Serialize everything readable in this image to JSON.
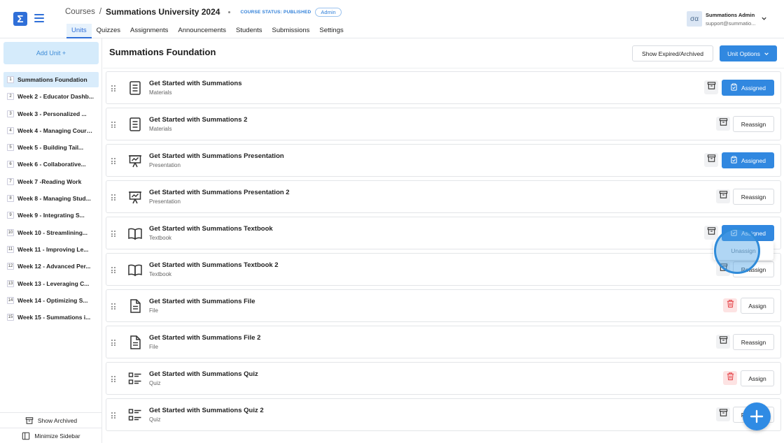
{
  "header": {
    "logo_glyph": "Σ",
    "breadcrumb": {
      "courses": "Courses",
      "separator": "/",
      "course": "Summations University 2024"
    },
    "course_status": "COURSE STATUS: PUBLISHED",
    "role_badge": "Admin",
    "tabs": [
      "Units",
      "Quizzes",
      "Assignments",
      "Announcements",
      "Students",
      "Submissions",
      "Settings"
    ],
    "active_tab": "Units",
    "user": {
      "avatar_text": "σα",
      "name": "Summations Admin",
      "email": "support@summatio..."
    }
  },
  "sidebar": {
    "add_unit_label": "Add Unit +",
    "units": [
      {
        "num": "1",
        "label": "Summations Foundation"
      },
      {
        "num": "2",
        "label": "Week 2 - Educator Dashb..."
      },
      {
        "num": "3",
        "label": "Week 3 - Personalized ..."
      },
      {
        "num": "4",
        "label": "Week 4 - Managing Cours..."
      },
      {
        "num": "5",
        "label": "Week 5 - Building Tail..."
      },
      {
        "num": "6",
        "label": "Week 6 - Collaborative..."
      },
      {
        "num": "7",
        "label": "Week 7 -Reading Work"
      },
      {
        "num": "8",
        "label": "Week 8 - Managing Stud..."
      },
      {
        "num": "9",
        "label": "Week 9 - Integrating S..."
      },
      {
        "num": "10",
        "label": "Week 10 - Streamlining..."
      },
      {
        "num": "11",
        "label": "Week 11 - Improving Le..."
      },
      {
        "num": "12",
        "label": "Week 12 - Advanced Per..."
      },
      {
        "num": "13",
        "label": "Week 13 - Leveraging C..."
      },
      {
        "num": "14",
        "label": "Week 14 - Optimizing S..."
      },
      {
        "num": "15",
        "label": "Week 15 - Summations i..."
      }
    ],
    "show_archived_label": "Show Archived",
    "minimize_label": "Minimize Sidebar"
  },
  "main": {
    "title": "Summations Foundation",
    "show_expired_label": "Show Expired/Archived",
    "unit_options_label": "Unit Options",
    "items": [
      {
        "title": "Get Started with Summations",
        "type": "Materials",
        "icon": "document-icon",
        "state": "Assigned",
        "archive_color": "grey"
      },
      {
        "title": "Get Started with Summations 2",
        "type": "Materials",
        "icon": "document-icon",
        "state": "Reassign",
        "archive_color": "grey"
      },
      {
        "title": "Get Started with Summations Presentation",
        "type": "Presentation",
        "icon": "presentation-icon",
        "state": "Assigned",
        "archive_color": "grey"
      },
      {
        "title": "Get Started with Summations Presentation 2",
        "type": "Presentation",
        "icon": "presentation-icon",
        "state": "Reassign",
        "archive_color": "grey"
      },
      {
        "title": "Get Started with Summations Textbook",
        "type": "Textbook",
        "icon": "book-icon",
        "state": "Assigned",
        "archive_color": "grey"
      },
      {
        "title": "Get Started with Summations Textbook 2",
        "type": "Textbook",
        "icon": "book-icon",
        "state": "Reassign",
        "archive_color": "grey"
      },
      {
        "title": "Get Started with Summations File",
        "type": "File",
        "icon": "file-icon",
        "state": "Assign",
        "archive_color": "red"
      },
      {
        "title": "Get Started with Summations File 2",
        "type": "File",
        "icon": "file-icon",
        "state": "Reassign",
        "archive_color": "grey"
      },
      {
        "title": "Get Started with Summations Quiz",
        "type": "Quiz",
        "icon": "quiz-icon",
        "state": "Assign",
        "archive_color": "red"
      },
      {
        "title": "Get Started with Summations Quiz 2",
        "type": "Quiz",
        "icon": "quiz-icon",
        "state": "Reassign",
        "archive_color": "grey"
      }
    ],
    "popup_label": "Unassign"
  },
  "colors": {
    "accent": "#3188e0",
    "active_bg": "#d9ecfb",
    "danger_bg": "#fde3e3",
    "danger": "#e5484d"
  }
}
